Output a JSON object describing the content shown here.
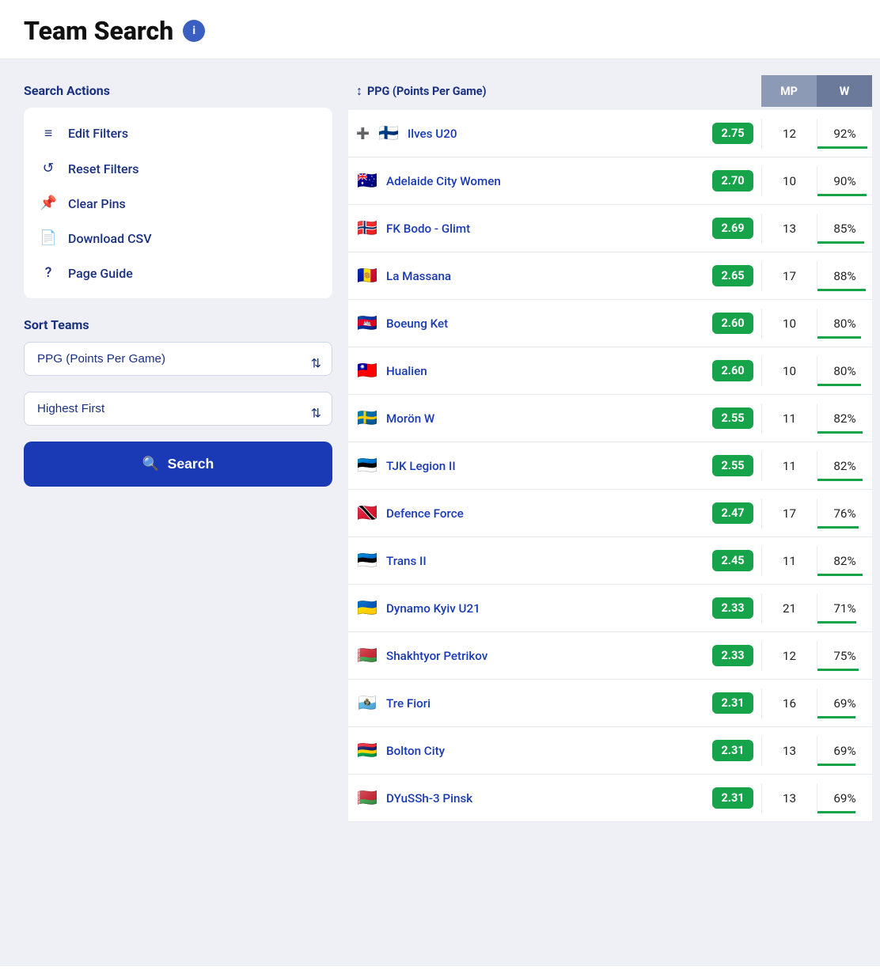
{
  "header": {
    "title": "Team Search",
    "info_tooltip": "Information"
  },
  "sidebar": {
    "search_actions_label": "Search Actions",
    "actions": [
      {
        "id": "edit-filters",
        "label": "Edit Filters",
        "icon": "≡"
      },
      {
        "id": "reset-filters",
        "label": "Reset Filters",
        "icon": "↺"
      },
      {
        "id": "clear-pins",
        "label": "Clear Pins",
        "icon": "📌"
      },
      {
        "id": "download-csv",
        "label": "Download CSV",
        "icon": "📄"
      },
      {
        "id": "page-guide",
        "label": "Page Guide",
        "icon": "?"
      }
    ],
    "sort_teams_label": "Sort Teams",
    "sort_by_label": "PPG (Points Per Game)",
    "sort_order_label": "Highest First",
    "search_button_label": "Search"
  },
  "table": {
    "col_sort_label": "PPG (Points Per Game)",
    "col_mp": "MP",
    "col_w": "W",
    "rows": [
      {
        "name": "Ilves U20",
        "flag": "🇫🇮",
        "ppg": "2.75",
        "mp": "12",
        "w": "92%",
        "w_pct": 92,
        "pin": true
      },
      {
        "name": "Adelaide City Women",
        "flag": "🇦🇺",
        "ppg": "2.70",
        "mp": "10",
        "w": "90%",
        "w_pct": 90,
        "pin": false
      },
      {
        "name": "FK Bodo - Glimt",
        "flag": "🇳🇴",
        "ppg": "2.69",
        "mp": "13",
        "w": "85%",
        "w_pct": 85,
        "pin": false
      },
      {
        "name": "La Massana",
        "flag": "🇦🇩",
        "ppg": "2.65",
        "mp": "17",
        "w": "88%",
        "w_pct": 88,
        "pin": false
      },
      {
        "name": "Boeung Ket",
        "flag": "🇰🇭",
        "ppg": "2.60",
        "mp": "10",
        "w": "80%",
        "w_pct": 80,
        "pin": false
      },
      {
        "name": "Hualien",
        "flag": "🇹🇼",
        "ppg": "2.60",
        "mp": "10",
        "w": "80%",
        "w_pct": 80,
        "pin": false
      },
      {
        "name": "Morön W",
        "flag": "🇸🇪",
        "ppg": "2.55",
        "mp": "11",
        "w": "82%",
        "w_pct": 82,
        "pin": false
      },
      {
        "name": "TJK Legion II",
        "flag": "🇪🇪",
        "ppg": "2.55",
        "mp": "11",
        "w": "82%",
        "w_pct": 82,
        "pin": false
      },
      {
        "name": "Defence Force",
        "flag": "🇹🇹",
        "ppg": "2.47",
        "mp": "17",
        "w": "76%",
        "w_pct": 76,
        "pin": false
      },
      {
        "name": "Trans II",
        "flag": "🇪🇪",
        "ppg": "2.45",
        "mp": "11",
        "w": "82%",
        "w_pct": 82,
        "pin": false
      },
      {
        "name": "Dynamo Kyiv U21",
        "flag": "🇺🇦",
        "ppg": "2.33",
        "mp": "21",
        "w": "71%",
        "w_pct": 71,
        "pin": false
      },
      {
        "name": "Shakhtyor Petrikov",
        "flag": "🇧🇾",
        "ppg": "2.33",
        "mp": "12",
        "w": "75%",
        "w_pct": 75,
        "pin": false
      },
      {
        "name": "Tre Fiori",
        "flag": "🇸🇲",
        "ppg": "2.31",
        "mp": "16",
        "w": "69%",
        "w_pct": 69,
        "pin": false
      },
      {
        "name": "Bolton City",
        "flag": "🇲🇺",
        "ppg": "2.31",
        "mp": "13",
        "w": "69%",
        "w_pct": 69,
        "pin": false
      },
      {
        "name": "DYuSSh-3 Pinsk",
        "flag": "🇧🇾",
        "ppg": "2.31",
        "mp": "13",
        "w": "69%",
        "w_pct": 69,
        "pin": false
      }
    ]
  }
}
